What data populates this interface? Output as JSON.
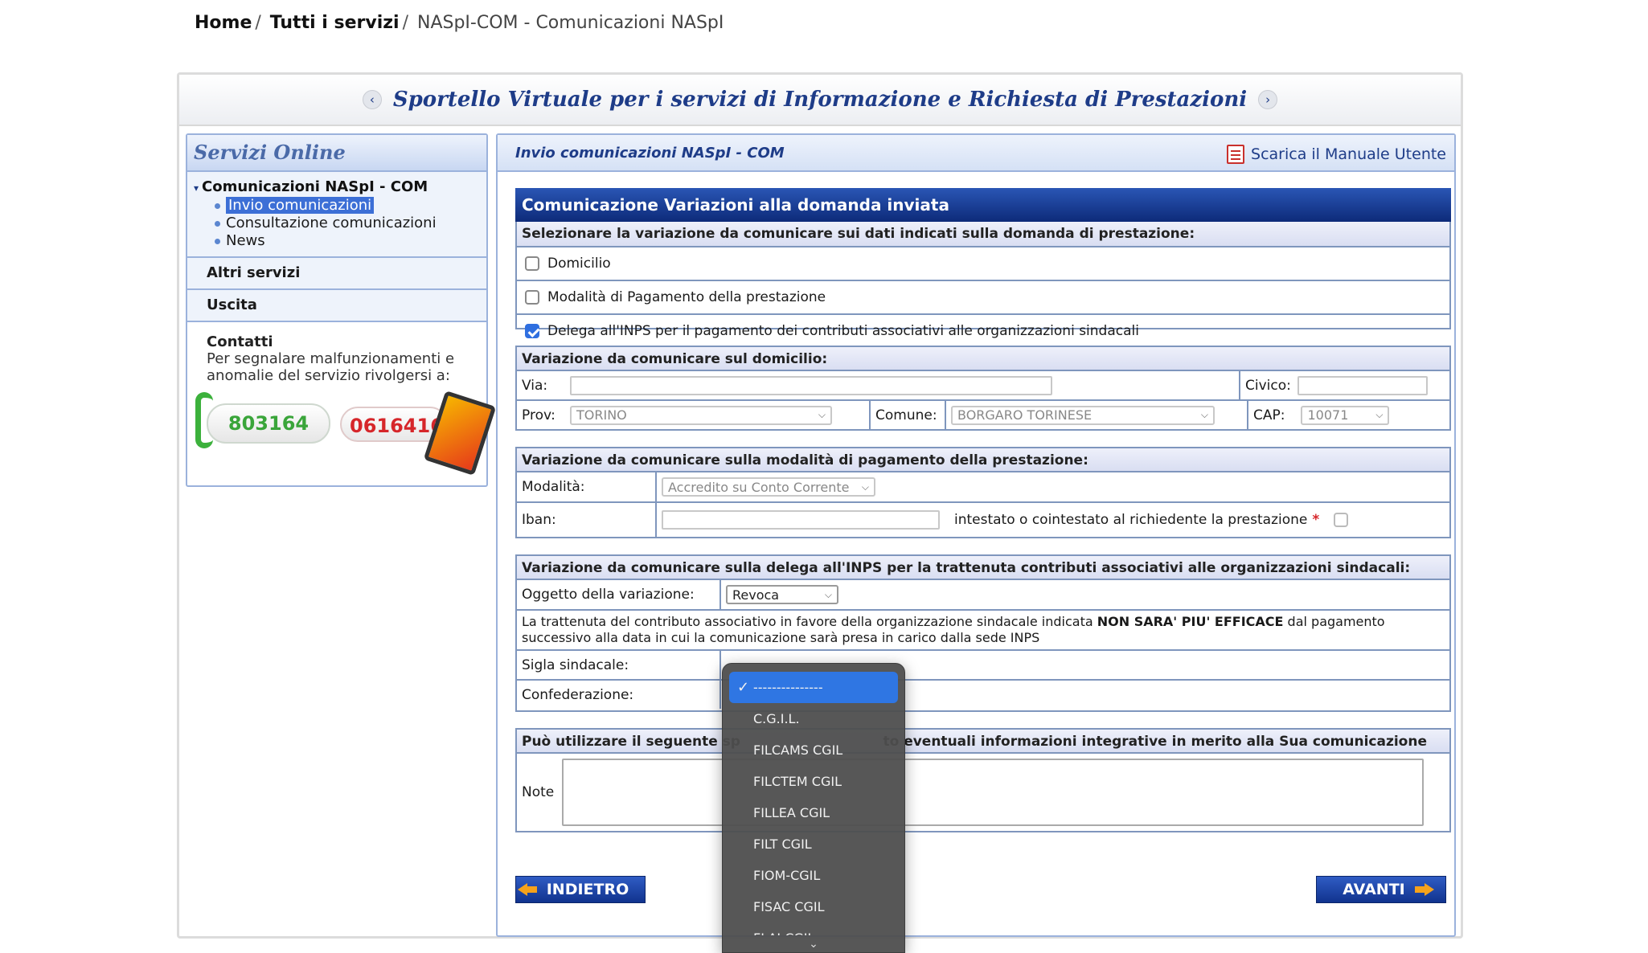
{
  "breadcrumb": {
    "home": "Home",
    "all_services": "Tutti i servizi",
    "current": "NASpI-COM - Comunicazioni NASpI",
    "sep": "/"
  },
  "header": {
    "title": "Sportello Virtuale per i servizi di Informazione e Richiesta di Prestazioni",
    "prev": "‹",
    "next": "›"
  },
  "sidebar": {
    "title": "Servizi Online",
    "group": "Comunicazioni NASpI - COM",
    "items": [
      {
        "label": "Invio comunicazioni"
      },
      {
        "label": "Consultazione comunicazioni"
      },
      {
        "label": "News"
      }
    ],
    "altri": "Altri servizi",
    "uscita": "Uscita",
    "contacts_title": "Contatti",
    "contacts_text": "Per segnalare malfunzionamenti e anomalie del servizio rivolgersi a:",
    "phone1": "803164",
    "phone2": "06164164"
  },
  "content": {
    "title": "Invio comunicazioni NASpI - COM",
    "manual": "Scarica il Manuale Utente",
    "banner": "Comunicazione Variazioni alla domanda inviata",
    "select_head": "Selezionare la variazione da comunicare sui dati indicati sulla domanda di prestazione:",
    "options": [
      {
        "label": "Domicilio",
        "checked": false
      },
      {
        "label": "Modalità di Pagamento della prestazione",
        "checked": false
      },
      {
        "label": "Delega all'INPS per il pagamento dei contributi associativi alle organizzazioni sindacali",
        "checked": true
      }
    ],
    "domicile": {
      "head": "Variazione da comunicare sul domicilio:",
      "via": "Via:",
      "civico": "Civico:",
      "prov": "Prov:",
      "prov_value": "TORINO",
      "comune": "Comune:",
      "comune_value": "BORGARO TORINESE",
      "cap": "CAP:",
      "cap_value": "10071"
    },
    "payment": {
      "head": "Variazione da comunicare sulla modalità di pagamento della prestazione:",
      "modalita": "Modalità:",
      "modalita_value": "Accredito su Conto Corrente",
      "iban": "Iban:",
      "intestato": "intestato o cointestato al richiedente la prestazione",
      "required": "*"
    },
    "delega": {
      "head": "Variazione da comunicare sulla delega all'INPS per la trattenuta contributi associativi alle organizzazioni sindacali:",
      "oggetto": "Oggetto della variazione:",
      "oggetto_value": "Revoca",
      "info_pre": "La trattenuta del contributo associativo in favore della organizzazione sindacale indicata ",
      "info_bold": "NON SARA' PIU' EFFICACE",
      "info_post": " dal pagamento successivo alla data in cui la comunicazione sarà presa in carico dalla sede INPS",
      "sigla": "Sigla sindacale:",
      "confederazione": "Confederazione:"
    },
    "notes": {
      "head_left": "Può utilizzare il seguente sp",
      "head_right": "to eventuali informazioni integrative in merito alla Sua comunicazione",
      "label": "Note"
    },
    "back": "INDIETRO",
    "next": "AVANTI"
  },
  "dropdown": {
    "items": [
      "---------------",
      "C.G.I.L.",
      "FILCAMS CGIL",
      "FILCTEM CGIL",
      "FILLEA CGIL",
      "FILT CGIL",
      "FIOM-CGIL",
      "FISAC CGIL",
      "FLAI CGIL"
    ],
    "more": "⌄"
  }
}
